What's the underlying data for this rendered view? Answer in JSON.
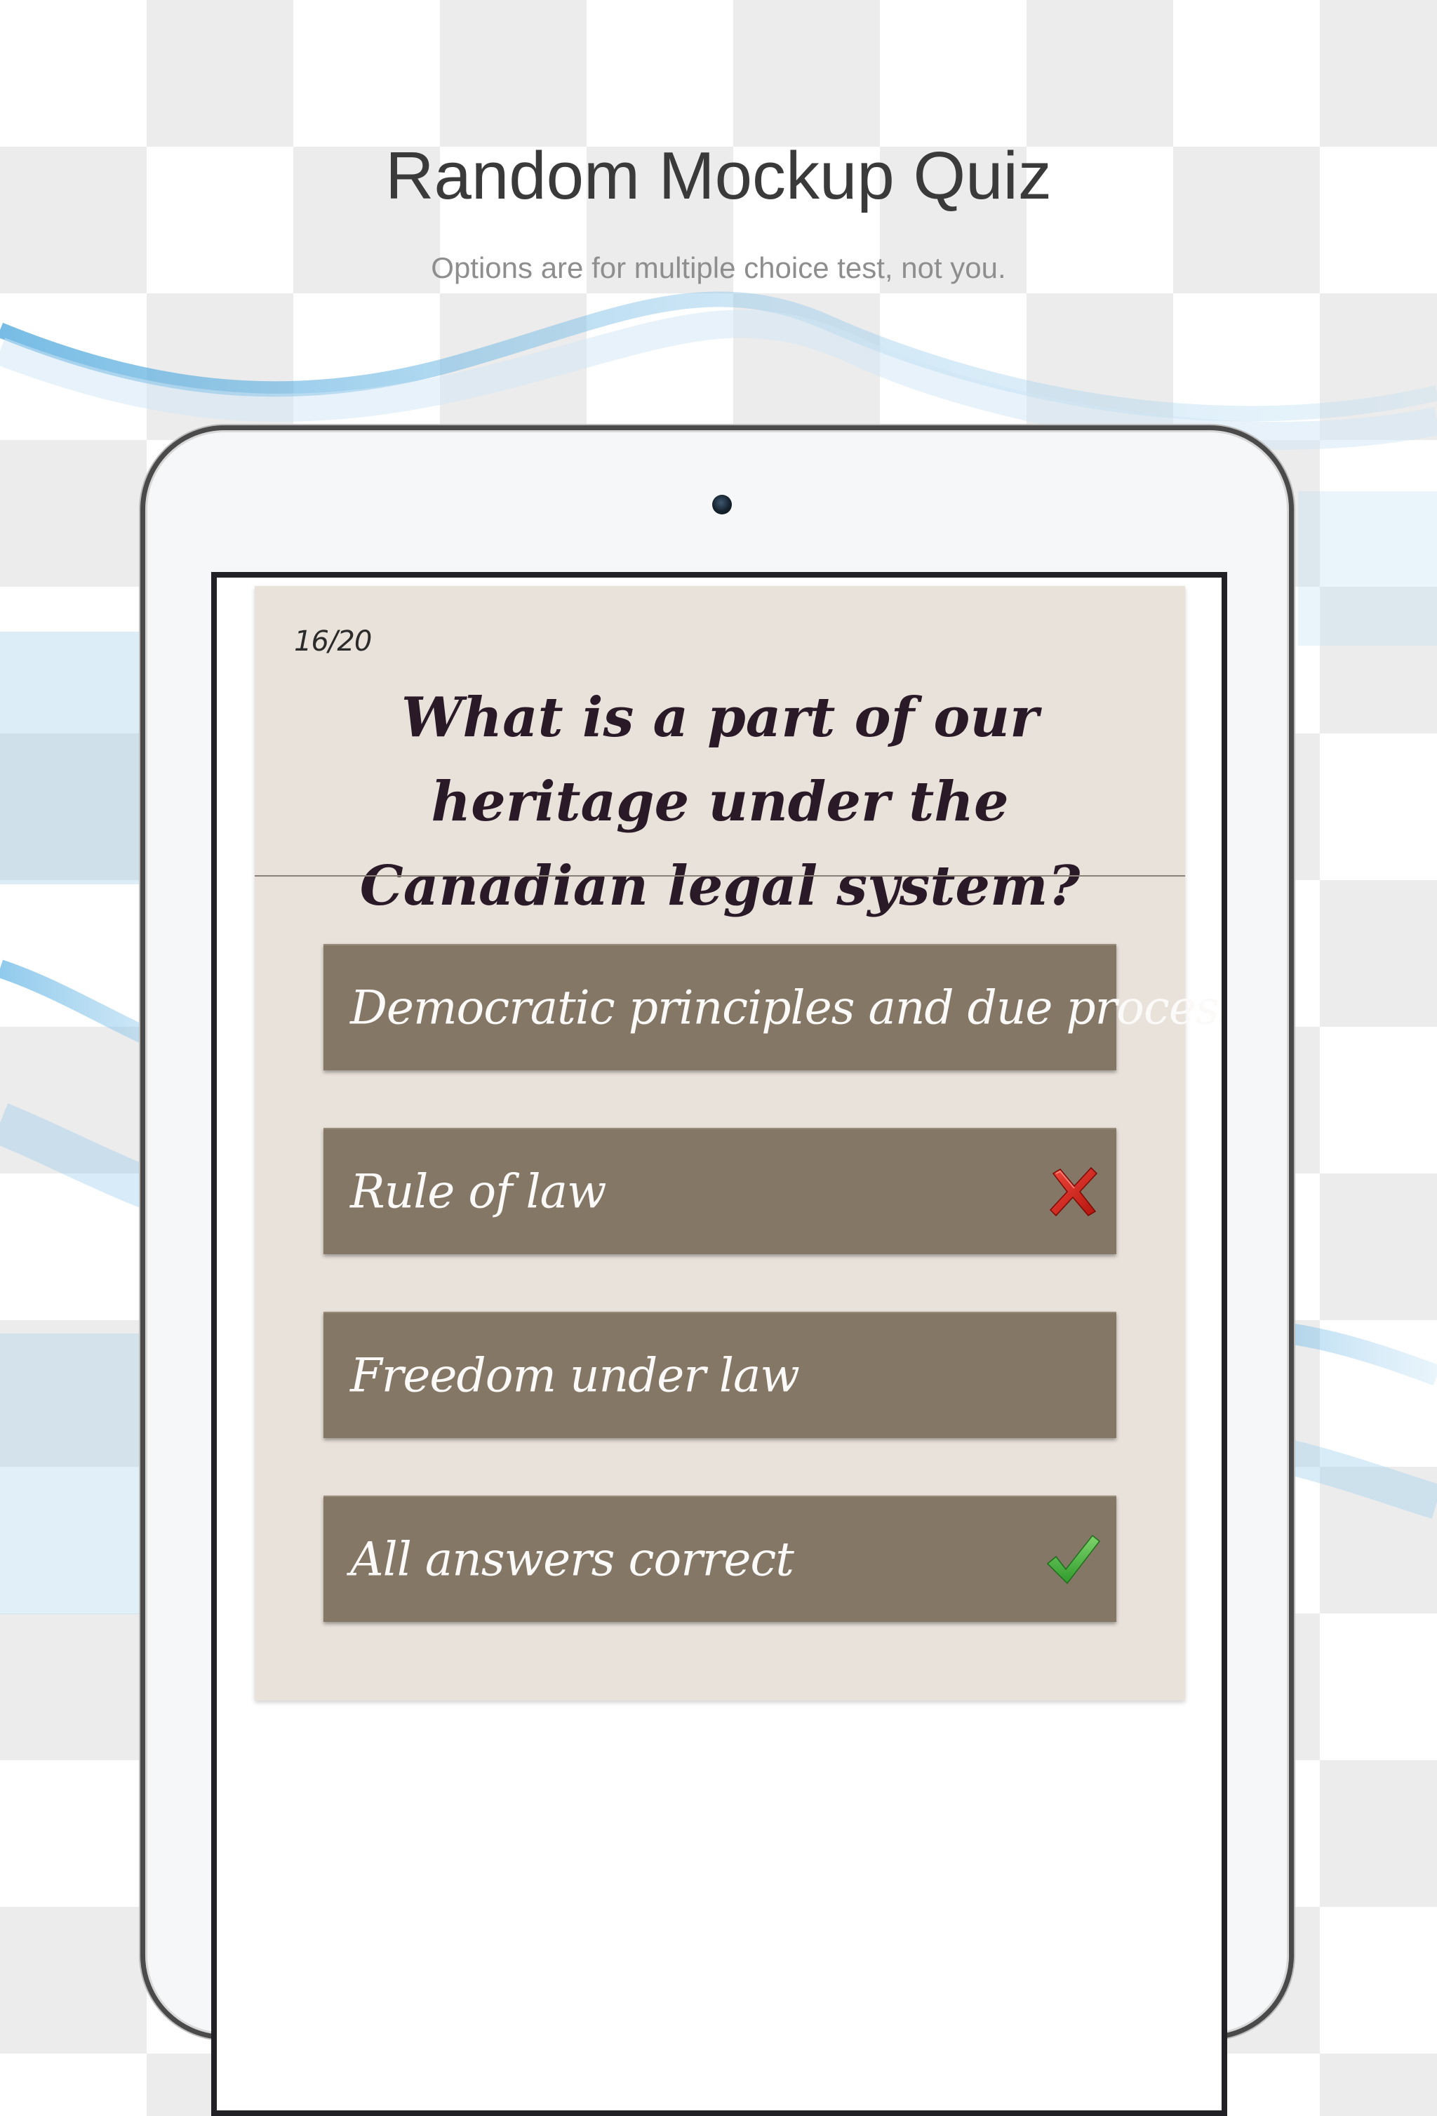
{
  "header": {
    "title": "Random Mockup Quiz",
    "subtitle": "Options are for multiple choice test, not you."
  },
  "quiz": {
    "progress": "16/20",
    "question": "What is a part of our heritage under the Canadian legal system?",
    "answers": [
      {
        "label": "Democratic principles and due process",
        "status": "none"
      },
      {
        "label": "Rule of law",
        "status": "incorrect",
        "icon": "cross-icon"
      },
      {
        "label": "Freedom under law",
        "status": "none"
      },
      {
        "label": "All answers correct",
        "status": "correct",
        "icon": "check-icon"
      }
    ]
  },
  "colors": {
    "card_background": "#e9e2da",
    "answer_background": "#857766",
    "question_text": "#2a1a28",
    "incorrect_mark": "#d8261c",
    "correct_mark": "#4cb84a"
  }
}
